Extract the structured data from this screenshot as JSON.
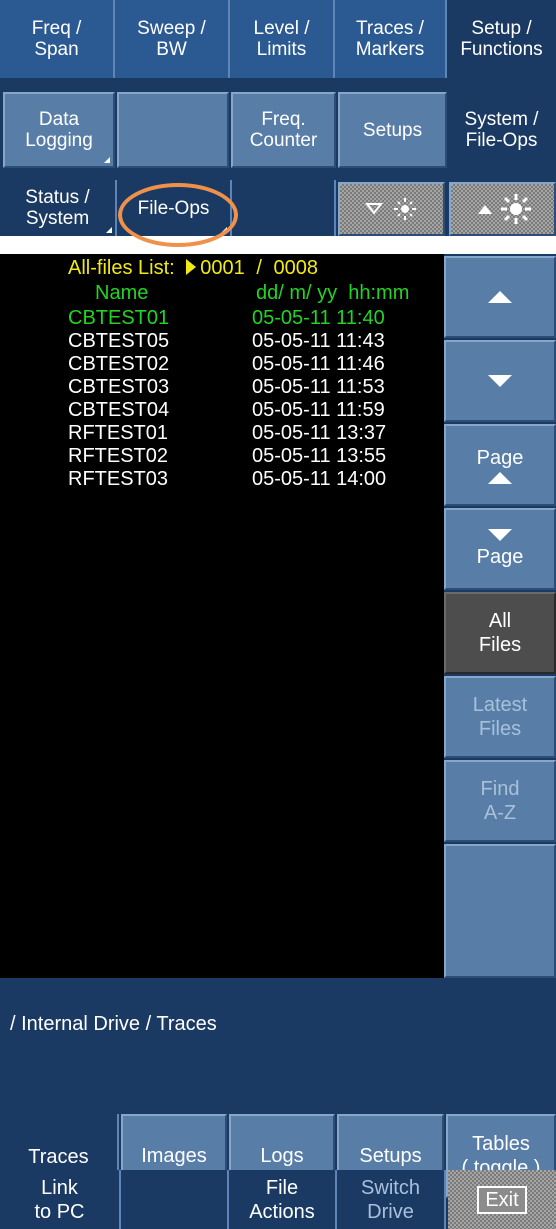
{
  "top_tabs": [
    {
      "label": "Freq /\nSpan"
    },
    {
      "label": "Sweep /\nBW"
    },
    {
      "label": "Level /\nLimits"
    },
    {
      "label": "Traces /\nMarkers"
    },
    {
      "label": "Setup /\nFunctions",
      "active": true
    }
  ],
  "softkeys_row1": [
    {
      "label": "Data\nLogging"
    },
    {
      "label": ""
    },
    {
      "label": "Freq.\nCounter"
    },
    {
      "label": "Setups"
    },
    {
      "label": "System /\nFile-Ops",
      "active": true
    }
  ],
  "softkeys_row2": [
    {
      "label": "Status /\nSystem"
    },
    {
      "label": "File-Ops"
    },
    {
      "label": ""
    },
    {
      "label": "brightness-down"
    },
    {
      "label": "brightness-up"
    }
  ],
  "file_list": {
    "title": "All-files List:",
    "page_current": "0001",
    "page_sep": "/",
    "page_total": "0008",
    "col_name": "Name",
    "col_date": "dd/ m/ yy  hh:mm",
    "selected_color": "#22d422",
    "header_color": "#f2ea14",
    "files": [
      {
        "name": "CBTEST01",
        "date": "05-05-11 11:40",
        "selected": true
      },
      {
        "name": "CBTEST05",
        "date": "05-05-11 11:43"
      },
      {
        "name": "CBTEST02",
        "date": "05-05-11 11:46"
      },
      {
        "name": "CBTEST03",
        "date": "05-05-11 11:53"
      },
      {
        "name": "CBTEST04",
        "date": "05-05-11 11:59"
      },
      {
        "name": "RFTEST01",
        "date": "05-05-11 13:37"
      },
      {
        "name": "RFTEST02",
        "date": "05-05-11 13:55"
      },
      {
        "name": "RFTEST03",
        "date": "05-05-11 14:00"
      }
    ]
  },
  "side_buttons": {
    "page_up_label": "Page",
    "page_down_label": "Page",
    "all_files": "All\nFiles",
    "latest_files": "Latest\nFiles",
    "find_az": "Find\nA-Z"
  },
  "path": "/ Internal Drive / Traces",
  "bottom_tabs": [
    {
      "label": "Traces",
      "active": true
    },
    {
      "label": "Images"
    },
    {
      "label": "Logs"
    },
    {
      "label": "Setups"
    },
    {
      "label": "Tables\n( toggle )"
    }
  ],
  "bottom_buttons": [
    {
      "label": "Link\nto PC"
    },
    {
      "label": ""
    },
    {
      "label": "File\nActions"
    },
    {
      "label": "Switch\nDrive",
      "disabled": true
    },
    {
      "label": "Exit"
    }
  ]
}
